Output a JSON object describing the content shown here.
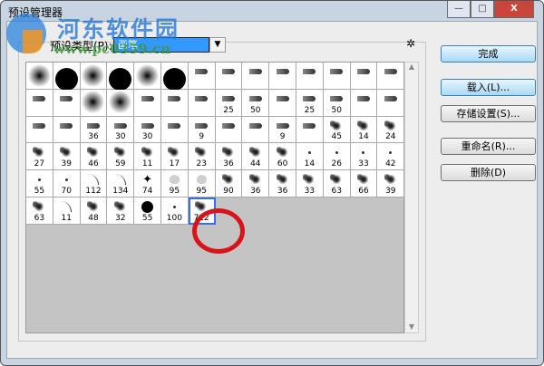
{
  "window": {
    "title": "预设管理器",
    "minimize": "—",
    "maximize": "□",
    "close": "X"
  },
  "watermark": {
    "name": "河东软件园",
    "url": "www.pc0359.cn"
  },
  "preset_type": {
    "label": "预设类型(P):",
    "value": "画笔"
  },
  "buttons": {
    "done": "完成",
    "load": "载入(L)...",
    "save": "存储设置(S)...",
    "rename": "重命名(R)...",
    "delete": "删除(D)"
  },
  "gear": "✲",
  "colors": {
    "accent": "#3399ff",
    "highlight_ring": "#d6141a"
  },
  "brushes": [
    [
      [
        "soft",
        ""
      ],
      [
        "hard",
        ""
      ],
      [
        "soft",
        ""
      ],
      [
        "hard",
        ""
      ],
      [
        "soft",
        ""
      ],
      [
        "hard",
        ""
      ],
      [
        "tip",
        ""
      ],
      [
        "tip",
        ""
      ],
      [
        "tip",
        ""
      ],
      [
        "tip",
        ""
      ],
      [
        "tip",
        ""
      ],
      [
        "tip",
        ""
      ],
      [
        "tip",
        ""
      ],
      [
        "tip",
        ""
      ]
    ],
    [
      [
        "tip",
        ""
      ],
      [
        "tip",
        ""
      ],
      [
        "soft",
        ""
      ],
      [
        "soft",
        ""
      ],
      [
        "tip",
        ""
      ],
      [
        "tip",
        ""
      ],
      [
        "tip",
        ""
      ],
      [
        "tip",
        "25"
      ],
      [
        "tip",
        "50"
      ],
      [
        "tip",
        ""
      ],
      [
        "tip",
        "25"
      ],
      [
        "tip",
        "50"
      ],
      [
        "tip",
        ""
      ],
      [
        "tip",
        ""
      ]
    ],
    [
      [
        "tip",
        ""
      ],
      [
        "tip",
        ""
      ],
      [
        "tip",
        "36"
      ],
      [
        "tip",
        "30"
      ],
      [
        "tip",
        "30"
      ],
      [
        "tip",
        ""
      ],
      [
        "tip",
        "9"
      ],
      [
        "tip",
        ""
      ],
      [
        "tip",
        ""
      ],
      [
        "tip",
        "9"
      ],
      [
        "tip",
        ""
      ],
      [
        "scatter",
        "45"
      ],
      [
        "scatter",
        "14"
      ],
      [
        "scatter",
        "24"
      ]
    ],
    [
      [
        "scatter",
        "27"
      ],
      [
        "scatter",
        "39"
      ],
      [
        "scatter",
        "46"
      ],
      [
        "scatter",
        "59"
      ],
      [
        "scatter",
        "11"
      ],
      [
        "scatter",
        "17"
      ],
      [
        "scatter",
        "23"
      ],
      [
        "scatter",
        "36"
      ],
      [
        "scatter",
        "44"
      ],
      [
        "scatter",
        "60"
      ],
      [
        "dot",
        "14"
      ],
      [
        "dot",
        "26"
      ],
      [
        "dot",
        "33"
      ],
      [
        "dot",
        "42"
      ]
    ],
    [
      [
        "dot",
        "55"
      ],
      [
        "dot",
        "70"
      ],
      [
        "grass",
        "112"
      ],
      [
        "grass",
        "134"
      ],
      [
        "leaf",
        "74"
      ],
      [
        "leafsoft",
        "95"
      ],
      [
        "leafsoft",
        "95"
      ],
      [
        "scatter",
        "90"
      ],
      [
        "scatter",
        "36"
      ],
      [
        "scatter",
        "36"
      ],
      [
        "scatter",
        "33"
      ],
      [
        "scatter",
        "63"
      ],
      [
        "scatter",
        "66"
      ],
      [
        "scatter",
        "39"
      ]
    ],
    [
      [
        "scatter",
        "63"
      ],
      [
        "grass",
        "11"
      ],
      [
        "scatter",
        "48"
      ],
      [
        "scatter",
        "32"
      ],
      [
        "hardsm",
        "55"
      ],
      [
        "dot",
        "100"
      ],
      [
        "scatter",
        "712"
      ]
    ]
  ]
}
